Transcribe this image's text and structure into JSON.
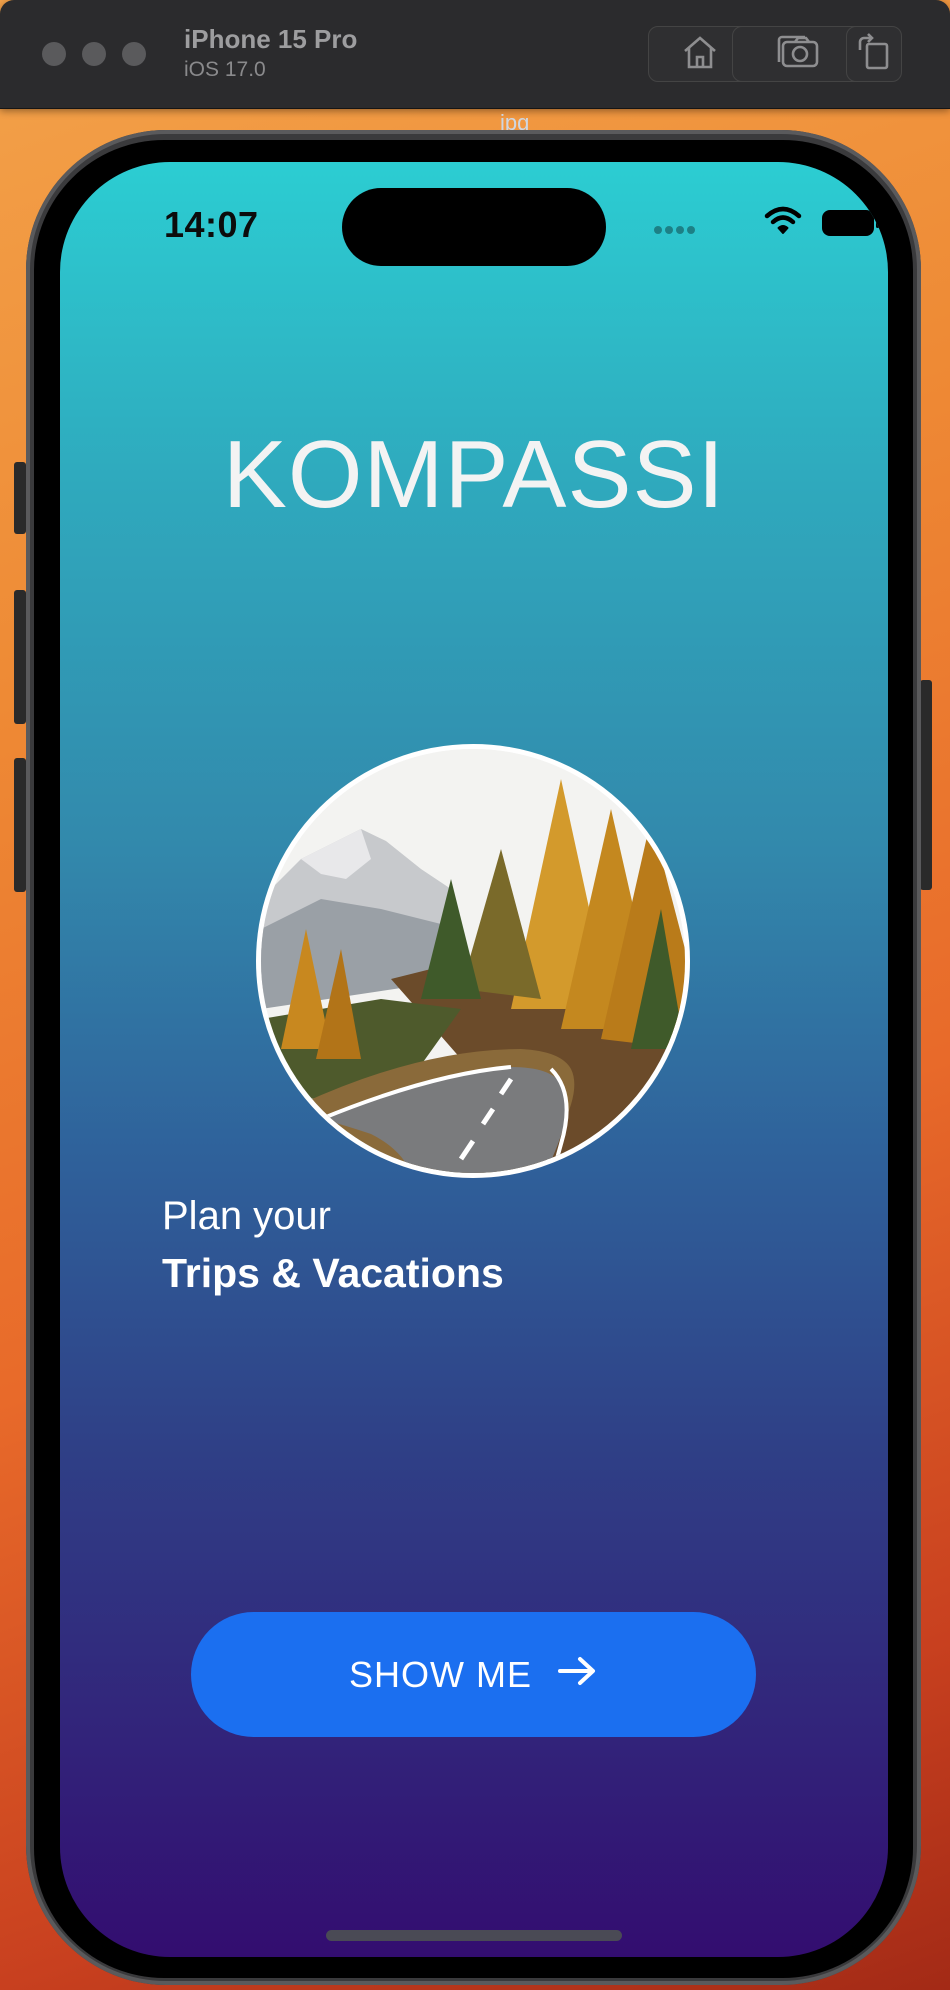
{
  "simulator": {
    "device_name": "iPhone 15 Pro",
    "os_version": "iOS 17.0",
    "buttons": [
      {
        "name": "home-button",
        "icon": "home-icon"
      },
      {
        "name": "screenshot-button",
        "icon": "camera-icon"
      },
      {
        "name": "rotate-button",
        "icon": "rotate-icon"
      }
    ],
    "file_label": "jpg"
  },
  "status_bar": {
    "time": "14:07",
    "icons": [
      "cellular-dots-icon",
      "wifi-icon",
      "battery-icon"
    ]
  },
  "app": {
    "title": "KOMPASSI",
    "hero_image": "mountain-road-photo",
    "tagline_line1": "Plan your",
    "tagline_line2": "Trips & Vacations",
    "cta_label": "SHOW ME",
    "cta_icon": "arrow-right-icon"
  },
  "colors": {
    "gradient_top": "#2ccdd2",
    "gradient_bottom": "#330d70",
    "cta_background": "#1b6ff0",
    "title_text": "#f3f3f3"
  }
}
